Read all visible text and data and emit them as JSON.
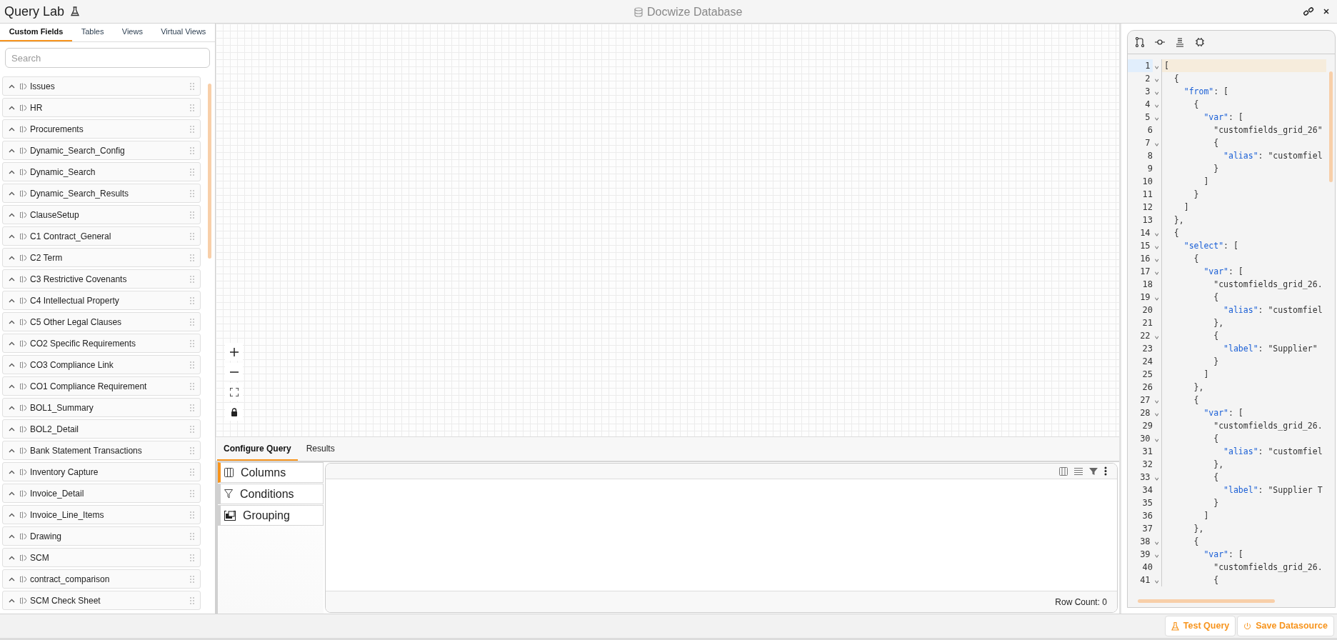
{
  "header": {
    "title": "Query Lab",
    "app_name": "Docwize Database"
  },
  "sidebar": {
    "tabs": [
      {
        "label": "Custom Fields",
        "selected": true
      },
      {
        "label": "Tables",
        "selected": false
      },
      {
        "label": "Views",
        "selected": false
      },
      {
        "label": "Virtual Views",
        "selected": false
      }
    ],
    "search": {
      "placeholder": "Search"
    },
    "items": [
      {
        "label": "Issues"
      },
      {
        "label": "HR"
      },
      {
        "label": "Procurements"
      },
      {
        "label": "Dynamic_Search_Config"
      },
      {
        "label": "Dynamic_Search"
      },
      {
        "label": "Dynamic_Search_Results"
      },
      {
        "label": "ClauseSetup"
      },
      {
        "label": "C1 Contract_General"
      },
      {
        "label": "C2 Term"
      },
      {
        "label": "C3 Restrictive Covenants"
      },
      {
        "label": "C4 Intellectual Property"
      },
      {
        "label": "C5 Other Legal Clauses"
      },
      {
        "label": "CO2 Specific Requirements"
      },
      {
        "label": "CO3 Compliance Link"
      },
      {
        "label": "CO1 Compliance Requirement"
      },
      {
        "label": "BOL1_Summary"
      },
      {
        "label": "BOL2_Detail"
      },
      {
        "label": "Bank Statement Transactions"
      },
      {
        "label": "Inventory Capture"
      },
      {
        "label": "Invoice_Detail"
      },
      {
        "label": "Invoice_Line_Items"
      },
      {
        "label": "Drawing"
      },
      {
        "label": "SCM"
      },
      {
        "label": "contract_comparison"
      },
      {
        "label": "SCM Check Sheet"
      }
    ]
  },
  "bottom_tabs": [
    {
      "label": "Configure Query",
      "selected": true
    },
    {
      "label": "Results",
      "selected": false
    }
  ],
  "config_sections": [
    {
      "label": "Columns",
      "kind": "columns",
      "selected": true
    },
    {
      "label": "Conditions",
      "kind": "conditions",
      "selected": false
    },
    {
      "label": "Grouping",
      "kind": "grouping",
      "selected": false
    }
  ],
  "grid": {
    "row_count": "Row Count: 0"
  },
  "code_editor": {
    "lines": [
      {
        "number": "1",
        "fold": true,
        "active": true,
        "kind": "plain",
        "text": "["
      },
      {
        "number": "2",
        "fold": true,
        "active": false,
        "kind": "plain",
        "text": "  {"
      },
      {
        "number": "3",
        "fold": true,
        "active": false,
        "kind": "key",
        "text": "    \"from\": ["
      },
      {
        "number": "4",
        "fold": true,
        "active": false,
        "kind": "plain",
        "text": "      {"
      },
      {
        "number": "5",
        "fold": true,
        "active": false,
        "kind": "key",
        "text": "        \"var\": ["
      },
      {
        "number": "6",
        "fold": false,
        "active": false,
        "kind": "plain",
        "text": "          \"customfields_grid_26\""
      },
      {
        "number": "7",
        "fold": true,
        "active": false,
        "kind": "plain",
        "text": "          {"
      },
      {
        "number": "8",
        "fold": false,
        "active": false,
        "kind": "key",
        "text": "            \"alias\": \"customfiel"
      },
      {
        "number": "9",
        "fold": false,
        "active": false,
        "kind": "plain",
        "text": "          }"
      },
      {
        "number": "10",
        "fold": false,
        "active": false,
        "kind": "plain",
        "text": "        ]"
      },
      {
        "number": "11",
        "fold": false,
        "active": false,
        "kind": "plain",
        "text": "      }"
      },
      {
        "number": "12",
        "fold": false,
        "active": false,
        "kind": "plain",
        "text": "    ]"
      },
      {
        "number": "13",
        "fold": false,
        "active": false,
        "kind": "plain",
        "text": "  },"
      },
      {
        "number": "14",
        "fold": true,
        "active": false,
        "kind": "plain",
        "text": "  {"
      },
      {
        "number": "15",
        "fold": true,
        "active": false,
        "kind": "key",
        "text": "    \"select\": ["
      },
      {
        "number": "16",
        "fold": true,
        "active": false,
        "kind": "plain",
        "text": "      {"
      },
      {
        "number": "17",
        "fold": true,
        "active": false,
        "kind": "key",
        "text": "        \"var\": ["
      },
      {
        "number": "18",
        "fold": false,
        "active": false,
        "kind": "plain",
        "text": "          \"customfields_grid_26."
      },
      {
        "number": "19",
        "fold": true,
        "active": false,
        "kind": "plain",
        "text": "          {"
      },
      {
        "number": "20",
        "fold": false,
        "active": false,
        "kind": "key",
        "text": "            \"alias\": \"customfiel"
      },
      {
        "number": "21",
        "fold": false,
        "active": false,
        "kind": "plain",
        "text": "          },"
      },
      {
        "number": "22",
        "fold": true,
        "active": false,
        "kind": "plain",
        "text": "          {"
      },
      {
        "number": "23",
        "fold": false,
        "active": false,
        "kind": "key",
        "text": "            \"label\": \"Supplier\""
      },
      {
        "number": "24",
        "fold": false,
        "active": false,
        "kind": "plain",
        "text": "          }"
      },
      {
        "number": "25",
        "fold": false,
        "active": false,
        "kind": "plain",
        "text": "        ]"
      },
      {
        "number": "26",
        "fold": false,
        "active": false,
        "kind": "plain",
        "text": "      },"
      },
      {
        "number": "27",
        "fold": true,
        "active": false,
        "kind": "plain",
        "text": "      {"
      },
      {
        "number": "28",
        "fold": true,
        "active": false,
        "kind": "key",
        "text": "        \"var\": ["
      },
      {
        "number": "29",
        "fold": false,
        "active": false,
        "kind": "plain",
        "text": "          \"customfields_grid_26."
      },
      {
        "number": "30",
        "fold": true,
        "active": false,
        "kind": "plain",
        "text": "          {"
      },
      {
        "number": "31",
        "fold": false,
        "active": false,
        "kind": "key",
        "text": "            \"alias\": \"customfiel"
      },
      {
        "number": "32",
        "fold": false,
        "active": false,
        "kind": "plain",
        "text": "          },"
      },
      {
        "number": "33",
        "fold": true,
        "active": false,
        "kind": "plain",
        "text": "          {"
      },
      {
        "number": "34",
        "fold": false,
        "active": false,
        "kind": "key",
        "text": "            \"label\": \"Supplier T"
      },
      {
        "number": "35",
        "fold": false,
        "active": false,
        "kind": "plain",
        "text": "          }"
      },
      {
        "number": "36",
        "fold": false,
        "active": false,
        "kind": "plain",
        "text": "        ]"
      },
      {
        "number": "37",
        "fold": false,
        "active": false,
        "kind": "plain",
        "text": "      },"
      },
      {
        "number": "38",
        "fold": true,
        "active": false,
        "kind": "plain",
        "text": "      {"
      },
      {
        "number": "39",
        "fold": true,
        "active": false,
        "kind": "key",
        "text": "        \"var\": ["
      },
      {
        "number": "40",
        "fold": false,
        "active": false,
        "kind": "plain",
        "text": "          \"customfields_grid_26."
      },
      {
        "number": "41",
        "fold": true,
        "active": false,
        "kind": "plain",
        "text": "          {"
      }
    ]
  },
  "footer": {
    "buttons": [
      {
        "label": "Test Query",
        "kind": "test"
      },
      {
        "label": "Save Datasource",
        "kind": "save"
      }
    ]
  }
}
